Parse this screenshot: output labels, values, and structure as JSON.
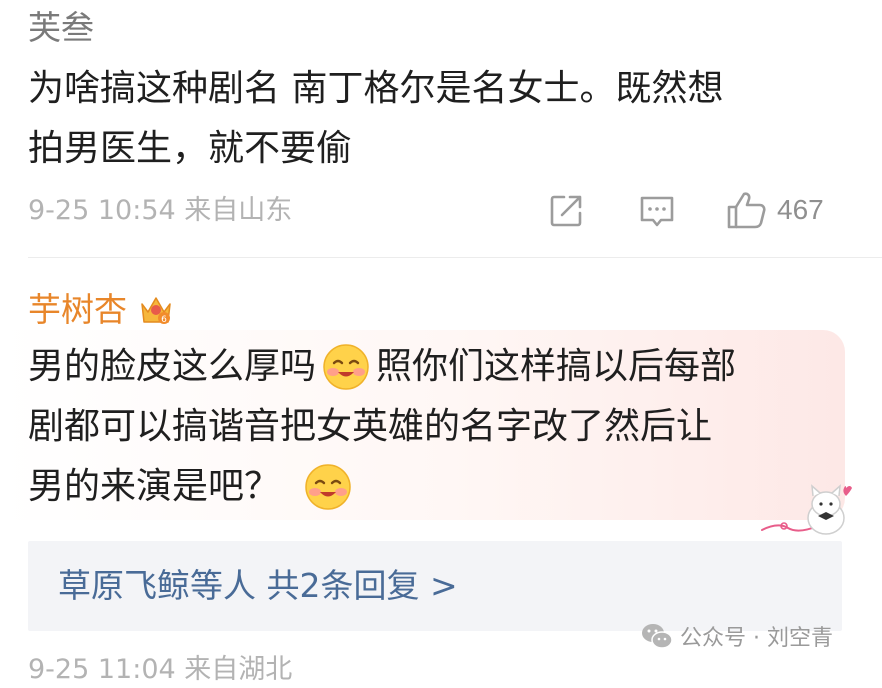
{
  "comment1": {
    "username": "芙叁",
    "lines": [
      "为啥搞这种剧名 南丁格尔是名女士。既然想",
      "拍男医生，就不要偷"
    ],
    "meta": "9-25 10:54 来自山东",
    "like_count": "467",
    "icons": [
      "share-icon",
      "comment-icon",
      "like-icon"
    ]
  },
  "comment2": {
    "username": "芋树杏",
    "badge": "crown-badge-icon",
    "line1_a": "男的脸皮这么厚吗",
    "line1_b": "照你们这样搞以后每部",
    "line2": "剧都可以搞谐音把女英雄的名字改了然后让",
    "line3": "男的来演是吧？",
    "emoji": "blush-emoji",
    "reply_summary": {
      "users": "草原飞鲸等人",
      "count_text": "共2条回复 >"
    }
  },
  "next_meta_partial": "9-25 11:04 来自湖北",
  "watermark": {
    "icon": "wechat-icon",
    "text": "公众号 · 刘空青"
  },
  "colors": {
    "username_highlight": "#e8862a",
    "link_blue": "#496b97",
    "meta_gray": "#b3b3b3"
  }
}
